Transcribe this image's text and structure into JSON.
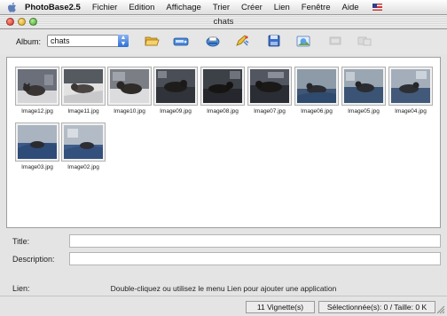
{
  "menubar": {
    "app": "PhotoBase2.5",
    "items": [
      "Fichier",
      "Edition",
      "Affichage",
      "Trier",
      "Créer",
      "Lien",
      "Fenêtre",
      "Aide"
    ]
  },
  "window": {
    "title": "chats"
  },
  "toolbar": {
    "album_label": "Album:",
    "album_value": "chats",
    "icons": [
      "folder-open-icon",
      "scanner-icon",
      "print-icon",
      "edit-tool-icon",
      "disk-icon",
      "image-icon",
      "slideshow-icon",
      "export-icon"
    ]
  },
  "thumbnails": [
    {
      "name": "Image12.jpg"
    },
    {
      "name": "Image11.jpg"
    },
    {
      "name": "Image10.jpg"
    },
    {
      "name": "Image09.jpg"
    },
    {
      "name": "Image08.jpg"
    },
    {
      "name": "Image07.jpg"
    },
    {
      "name": "Image06.jpg"
    },
    {
      "name": "Image05.jpg"
    },
    {
      "name": "Image04.jpg"
    },
    {
      "name": "Image03.jpg"
    },
    {
      "name": "Image02.jpg"
    }
  ],
  "fields": {
    "title_label": "Title:",
    "title_value": "",
    "description_label": "Description:",
    "description_value": "",
    "lien_label": "Lien:",
    "lien_help": "Double-cliquez ou utilisez le menu Lien pour ajouter une application"
  },
  "status": {
    "count": "11 Vignette(s)",
    "selection": "Sélectionnée(s): 0 / Taille: 0 K"
  }
}
